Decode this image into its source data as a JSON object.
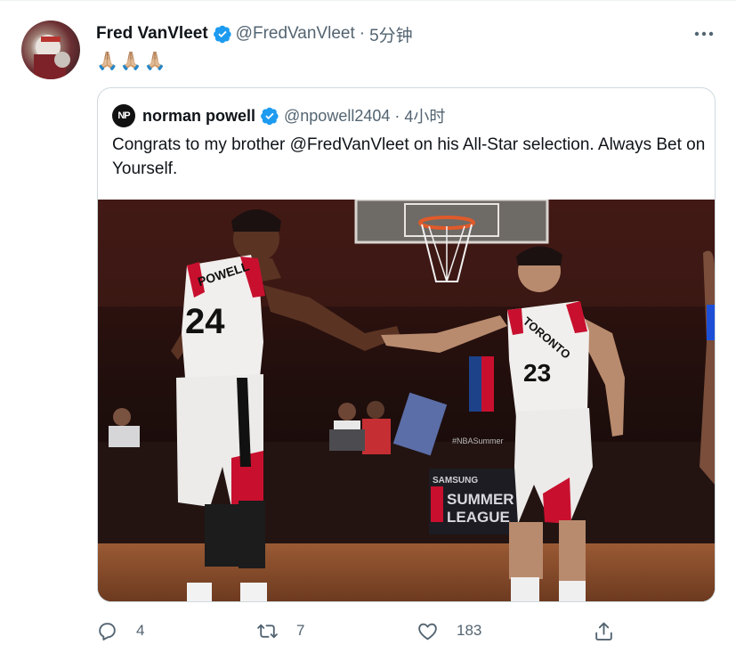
{
  "tweet": {
    "author_name": "Fred VanVleet",
    "author_handle": "@FredVanVleet",
    "separator": "·",
    "time": "5分钟",
    "text": "🙏🏼🙏🏼🙏🏼"
  },
  "quoted": {
    "avatar_initials": "NP",
    "author_name": "norman powell",
    "author_handle": "@npowell2404",
    "separator": "·",
    "time": "4小时",
    "text": "Congrats to my brother @FredVanVleet on his All-Star selection. Always Bet on Yourself.",
    "photo": {
      "jersey_left_name": "POWELL",
      "jersey_left_number": "24",
      "jersey_right_team": "TORONTO",
      "jersey_right_number": "23",
      "banner_top": "SAMSUNG",
      "banner_main": "SUMMER",
      "banner_sub": "LEAGUE",
      "hashtag": "#NBASummer"
    }
  },
  "actions": {
    "reply_count": "4",
    "retweet_count": "7",
    "like_count": "183"
  },
  "icons": {
    "verified": "verified-badge-icon",
    "more": "more-icon",
    "reply": "reply-icon",
    "retweet": "retweet-icon",
    "like": "like-icon",
    "share": "share-icon"
  },
  "colors": {
    "verified": "#1d9bf0",
    "secondary_text": "#536471",
    "border": "#cfd9de"
  }
}
